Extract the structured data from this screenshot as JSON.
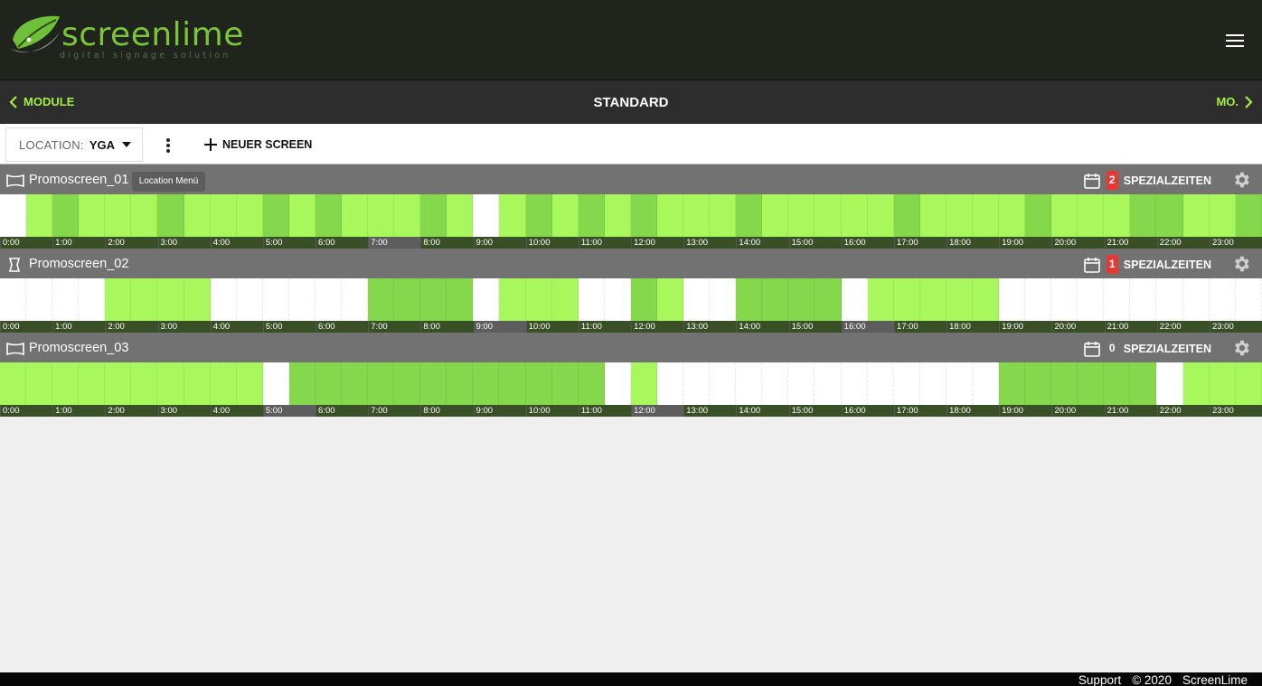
{
  "brand": {
    "name": "screenlime",
    "tagline": "digital signage solution"
  },
  "nav": {
    "back_label": "MODULE",
    "title": "STANDARD",
    "next_label": "MO."
  },
  "toolbar": {
    "location_label": "LOCATION:",
    "location_value": "YGA",
    "new_screen_label": "NEUER SCREEN",
    "tooltip": "Location Menü"
  },
  "hours": [
    "0:00",
    "1:00",
    "2:00",
    "3:00",
    "4:00",
    "5:00",
    "6:00",
    "7:00",
    "8:00",
    "9:00",
    "10:00",
    "11:00",
    "12:00",
    "13:00",
    "14:00",
    "15:00",
    "16:00",
    "17:00",
    "18:00",
    "19:00",
    "20:00",
    "21:00",
    "22:00",
    "23:00"
  ],
  "screens": [
    {
      "name": "Promoscreen_01",
      "orientation": "landscape",
      "special_count": "2",
      "special_label": "SPEZIALZEITEN",
      "slots": "wldllldllldldllldlwldldldllldllllldlllldlllddlldlllldllllld"
    },
    {
      "name": "Promoscreen_02",
      "orientation": "portrait",
      "special_count": "1",
      "special_label": "SPEZIALZEITEN",
      "slots": "wwwwllllwwwwwwddddwlllwwdlwwddddwlllllwwwwwwwwwwww"
    },
    {
      "name": "Promoscreen_03",
      "orientation": "landscape",
      "special_count": "0",
      "special_label": "SPEZIALZEITEN",
      "slots": "llllllllllwddddddddddddwlwwwwwwwwwwwwwddddddwlllllll"
    }
  ],
  "footer": {
    "support": "Support",
    "copyright": "© 2020",
    "company": "ScreenLime"
  },
  "colors": {
    "accent": "#a4ee44",
    "slot_light": "#a7f75d",
    "slot_dark": "#85d84c",
    "badge_red": "#e53935"
  }
}
